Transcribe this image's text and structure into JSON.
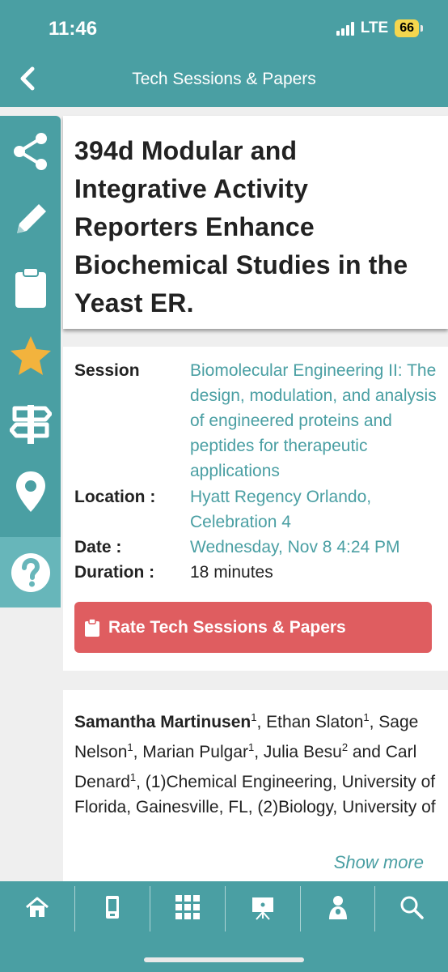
{
  "status": {
    "time": "11:46",
    "network": "LTE",
    "battery": "66"
  },
  "header": {
    "title": "Tech Sessions & Papers"
  },
  "sidebar": {
    "items": [
      "share",
      "edit",
      "clipboard",
      "favorite",
      "directions",
      "location",
      "help"
    ]
  },
  "paper": {
    "title": "394d Modular and Integrative Activity Reporters Enhance Biochemical Studies in the Yeast ER."
  },
  "details": {
    "session_label": "Session",
    "session_value": "Biomolecular Engineering II: The design, modulation, and analysis of engineered proteins and peptides for therapeutic applications",
    "location_label": "Location :",
    "location_value": "Hyatt Regency Orlando, Celebration 4",
    "date_label": "Date :",
    "date_value": "Wednesday, Nov 8 4:24 PM",
    "duration_label": "Duration :",
    "duration_value": "18 minutes"
  },
  "rate_button": {
    "label": "Rate Tech Sessions & Papers"
  },
  "authors": {
    "a1": "Samantha Martinusen",
    "a2": "Ethan Slaton",
    "a3": "Sage Nelson",
    "a4": "Marian Pulgar",
    "a5": "Julia Besu",
    "a6": "Carl Denard",
    "aff": "(1)Chemical Engineering, University of Florida, Gainesville, FL, (2)Biology, University of",
    "show_more": "Show more"
  },
  "tabbar": {
    "items": [
      "home",
      "mobile",
      "grid",
      "presentation",
      "speaker",
      "search"
    ]
  },
  "colors": {
    "teal": "#4a9fa3",
    "rate_red": "#df5d60",
    "star": "#f2b33d"
  }
}
